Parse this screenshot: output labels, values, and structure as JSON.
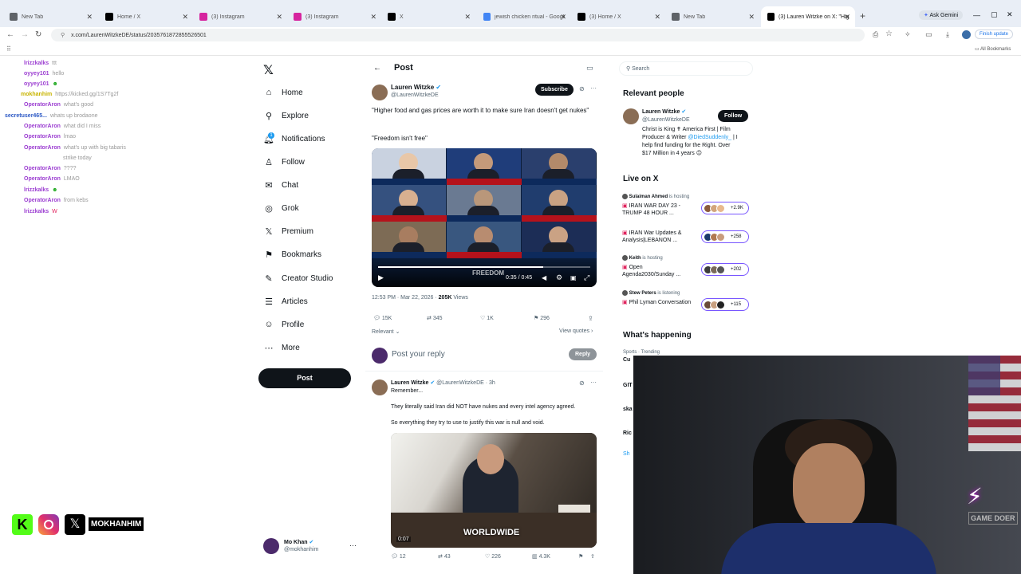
{
  "browser": {
    "tabs": [
      {
        "label": "New Tab",
        "color": "#5f6368"
      },
      {
        "label": "Home / X",
        "color": "#000000"
      },
      {
        "label": "(3) Instagram",
        "color": "#d6249f"
      },
      {
        "label": "(3) Instagram",
        "color": "#d6249f"
      },
      {
        "label": "X",
        "color": "#000000"
      },
      {
        "label": "jewish chicken ritual - Google S...",
        "color": "#4285f4"
      },
      {
        "label": "(3) Home / X",
        "color": "#000000"
      },
      {
        "label": "New Tab",
        "color": "#5f6368"
      },
      {
        "label": "(3) Lauren Witzke on X: \"High...",
        "color": "#000000"
      }
    ],
    "ask_gemini": "Ask Gemini",
    "url": "x.com/LaurenWitzkeDE/status/2035761872855526501",
    "finish_update": "Finish update",
    "all_bookmarks": "All Bookmarks"
  },
  "chat": [
    {
      "user": "lrizzkalks",
      "color": "#9b3dd1",
      "msg": "ttt"
    },
    {
      "user": "oyyey101",
      "color": "#9b3dd1",
      "msg": "hello"
    },
    {
      "user": "oyyey101",
      "color": "#9b3dd1",
      "msg": "☻"
    },
    {
      "user": "mokhanhim",
      "color": "#c8b400",
      "msg": "https://kicked.gg/1S7Tg2f"
    },
    {
      "user": "OperatorAron",
      "color": "#9b3dd1",
      "msg": "what's good"
    },
    {
      "user": "secretuser465...",
      "color": "#2a57c4",
      "msg": "whats up brodaone"
    },
    {
      "user": "OperatorAron",
      "color": "#9b3dd1",
      "msg": "what did I miss"
    },
    {
      "user": "OperatorAron",
      "color": "#9b3dd1",
      "msg": "lmao"
    },
    {
      "user": "OperatorAron",
      "color": "#9b3dd1",
      "msg": "what's up with big tabaris"
    },
    {
      "user": "",
      "color": "#9b3dd1",
      "msg": "strike today"
    },
    {
      "user": "OperatorAron",
      "color": "#9b3dd1",
      "msg": "????"
    },
    {
      "user": "OperatorAron",
      "color": "#9b3dd1",
      "msg": "LMAO"
    },
    {
      "user": "lrizzkalks",
      "color": "#9b3dd1",
      "msg": "☻"
    },
    {
      "user": "OperatorAron",
      "color": "#9b3dd1",
      "msg": "from kebs"
    },
    {
      "user": "lrizzkalks",
      "color": "#9b3dd1",
      "msg": "W"
    }
  ],
  "socials": {
    "handle": "MOKHANHIM"
  },
  "nav": {
    "items": [
      "Home",
      "Explore",
      "Notifications",
      "Follow",
      "Chat",
      "Grok",
      "Premium",
      "Bookmarks",
      "Creator Studio",
      "Articles",
      "Profile",
      "More"
    ],
    "notif_badge": "1",
    "post_button": "Post",
    "account_name": "Mo Khan",
    "account_handle": "@mokhanhim",
    "more_dots": "···"
  },
  "post": {
    "header": "Post",
    "author": "Lauren Witzke",
    "handle": "@LaurenWitzkeDE",
    "subscribe": "Subscribe",
    "text1": "\"Higher food and gas prices are worth it to make sure Iran doesn't get nukes\"",
    "text2": "\"Freedom isn't free\"",
    "video_watermark": "FREEDOM",
    "video_time": "0:35 / 0:45",
    "media_captions": [
      "",
      "",
      "",
      "",
      "",
      "",
      "",
      "",
      ""
    ],
    "timestamp": "12:53 PM · Mar 22, 2026 · ",
    "views_count": "205K",
    "views_label": " Views",
    "replies": "15K",
    "reposts": "345",
    "likes": "1K",
    "bookmarks": "296",
    "sort_label": "Relevant",
    "view_quotes": "View quotes ›",
    "reply_placeholder": "Post your reply",
    "reply_button": "Reply"
  },
  "reply": {
    "author": "Lauren Witzke",
    "meta": "@LaurenWitzkeDE · 3h",
    "remember": "Remember...",
    "line1": "They literally said Iran did NOT have nukes and every intel agency agreed.",
    "line2": "So everything they try to use to justify this war is null and void.",
    "video_caption": "WORLDWIDE",
    "video_time": "0:07",
    "stats": {
      "replies": "12",
      "reposts": "43",
      "likes": "226",
      "views": "4.3K"
    }
  },
  "right": {
    "search_placeholder": "Search",
    "relevant_title": "Relevant people",
    "rp_name": "Lauren Witzke",
    "rp_handle": "@LaurenWitzkeDE",
    "rp_follow": "Follow",
    "rp_bio1": "Christ is King ✝ America First | Film",
    "rp_bio2": "Producer & Writer ",
    "rp_bio_link": "@DiedSuddenly_",
    "rp_bio3": " | I",
    "rp_bio4": "help find funding for the Right. Over",
    "rp_bio5": "$17 Million in 4 years 😉",
    "live_title": "Live on X",
    "live": [
      {
        "host": "Sulaiman Ahmed",
        "status": "is hosting",
        "title": "IRAN WAR DAY 23 - TRUMP 48 HOUR ...",
        "count": "+2.9K"
      },
      {
        "host": "",
        "status": "",
        "title": "IRAN War Updates & Analysis|LEBANON ...",
        "count": "+258"
      },
      {
        "host": "Keith",
        "status": "is hosting",
        "title": "Open Agenda2030/Sunday ...",
        "count": "+202"
      },
      {
        "host": "Stew Peters",
        "status": "is listening",
        "title": "Phil Lyman Conversation",
        "count": "+115"
      }
    ],
    "happening_title": "What's happening",
    "trend_cat": "Sports · Trending",
    "trend_partial": [
      "Cu",
      "GIT",
      "ska",
      "Ric",
      "Sh"
    ]
  },
  "webcam": {
    "chair_text": "GAME DOER"
  }
}
